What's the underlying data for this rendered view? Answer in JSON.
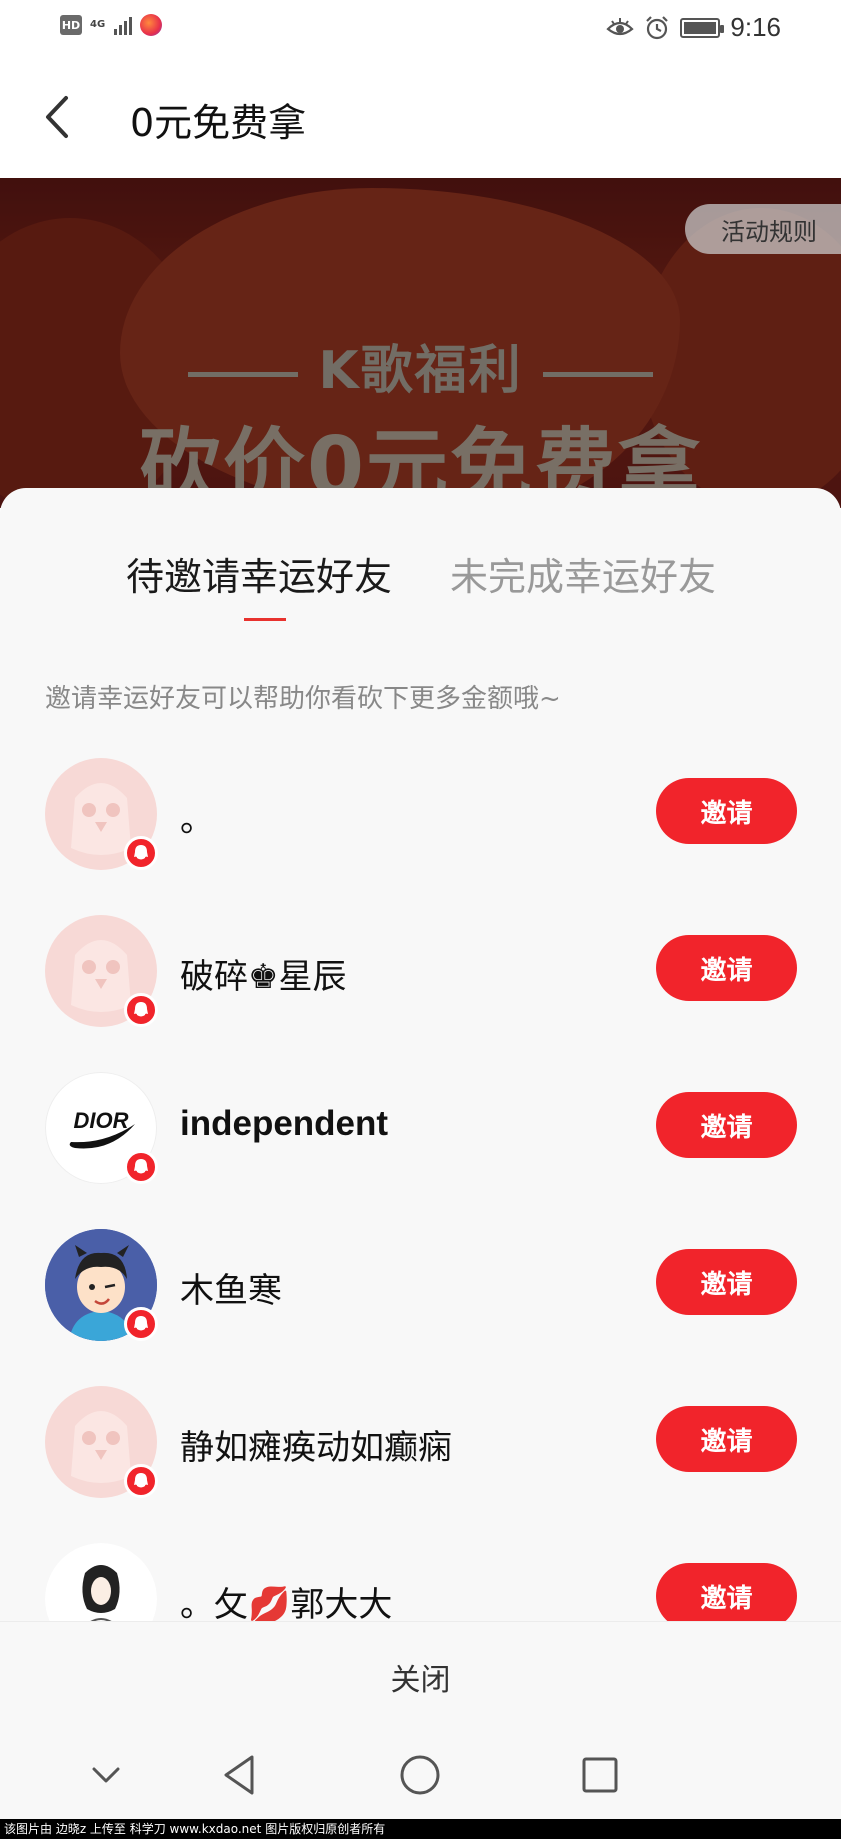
{
  "status_bar": {
    "hd": "HD",
    "network": "4G",
    "time": "9:16"
  },
  "header": {
    "title": "0元免费拿"
  },
  "banner": {
    "rules_button": "活动规则",
    "subtitle": "K歌福利",
    "headline": "砍价0元免费拿"
  },
  "sheet": {
    "tabs": [
      {
        "label": "待邀请幸运好友",
        "active": true
      },
      {
        "label": "未完成幸运好友",
        "active": false
      }
    ],
    "hint": "邀请幸运好友可以帮助你看砍下更多金额哦~",
    "friends": [
      {
        "name": "。",
        "avatar": "placeholder-bird",
        "invite_label": "邀请"
      },
      {
        "name": "破碎♚星辰",
        "avatar": "placeholder-bird",
        "invite_label": "邀请"
      },
      {
        "name": "independent",
        "avatar": "dior-logo",
        "invite_label": "邀请",
        "avatar_text": "DIOR"
      },
      {
        "name": "木鱼寒",
        "avatar": "cartoon-boy",
        "invite_label": "邀请"
      },
      {
        "name": "静如瘫痪动如癫痫",
        "avatar": "placeholder-bird",
        "invite_label": "邀请"
      },
      {
        "name": "。攵💋郭大大",
        "avatar": "woman-sketch",
        "invite_label": "邀请"
      }
    ],
    "close_label": "关闭"
  },
  "watermark": "该图片由 边晓z 上传至 科学刀 www.kxdao.net 图片版权归原创者所有",
  "colors": {
    "accent": "#f1242b",
    "indicator": "#e8322e"
  }
}
